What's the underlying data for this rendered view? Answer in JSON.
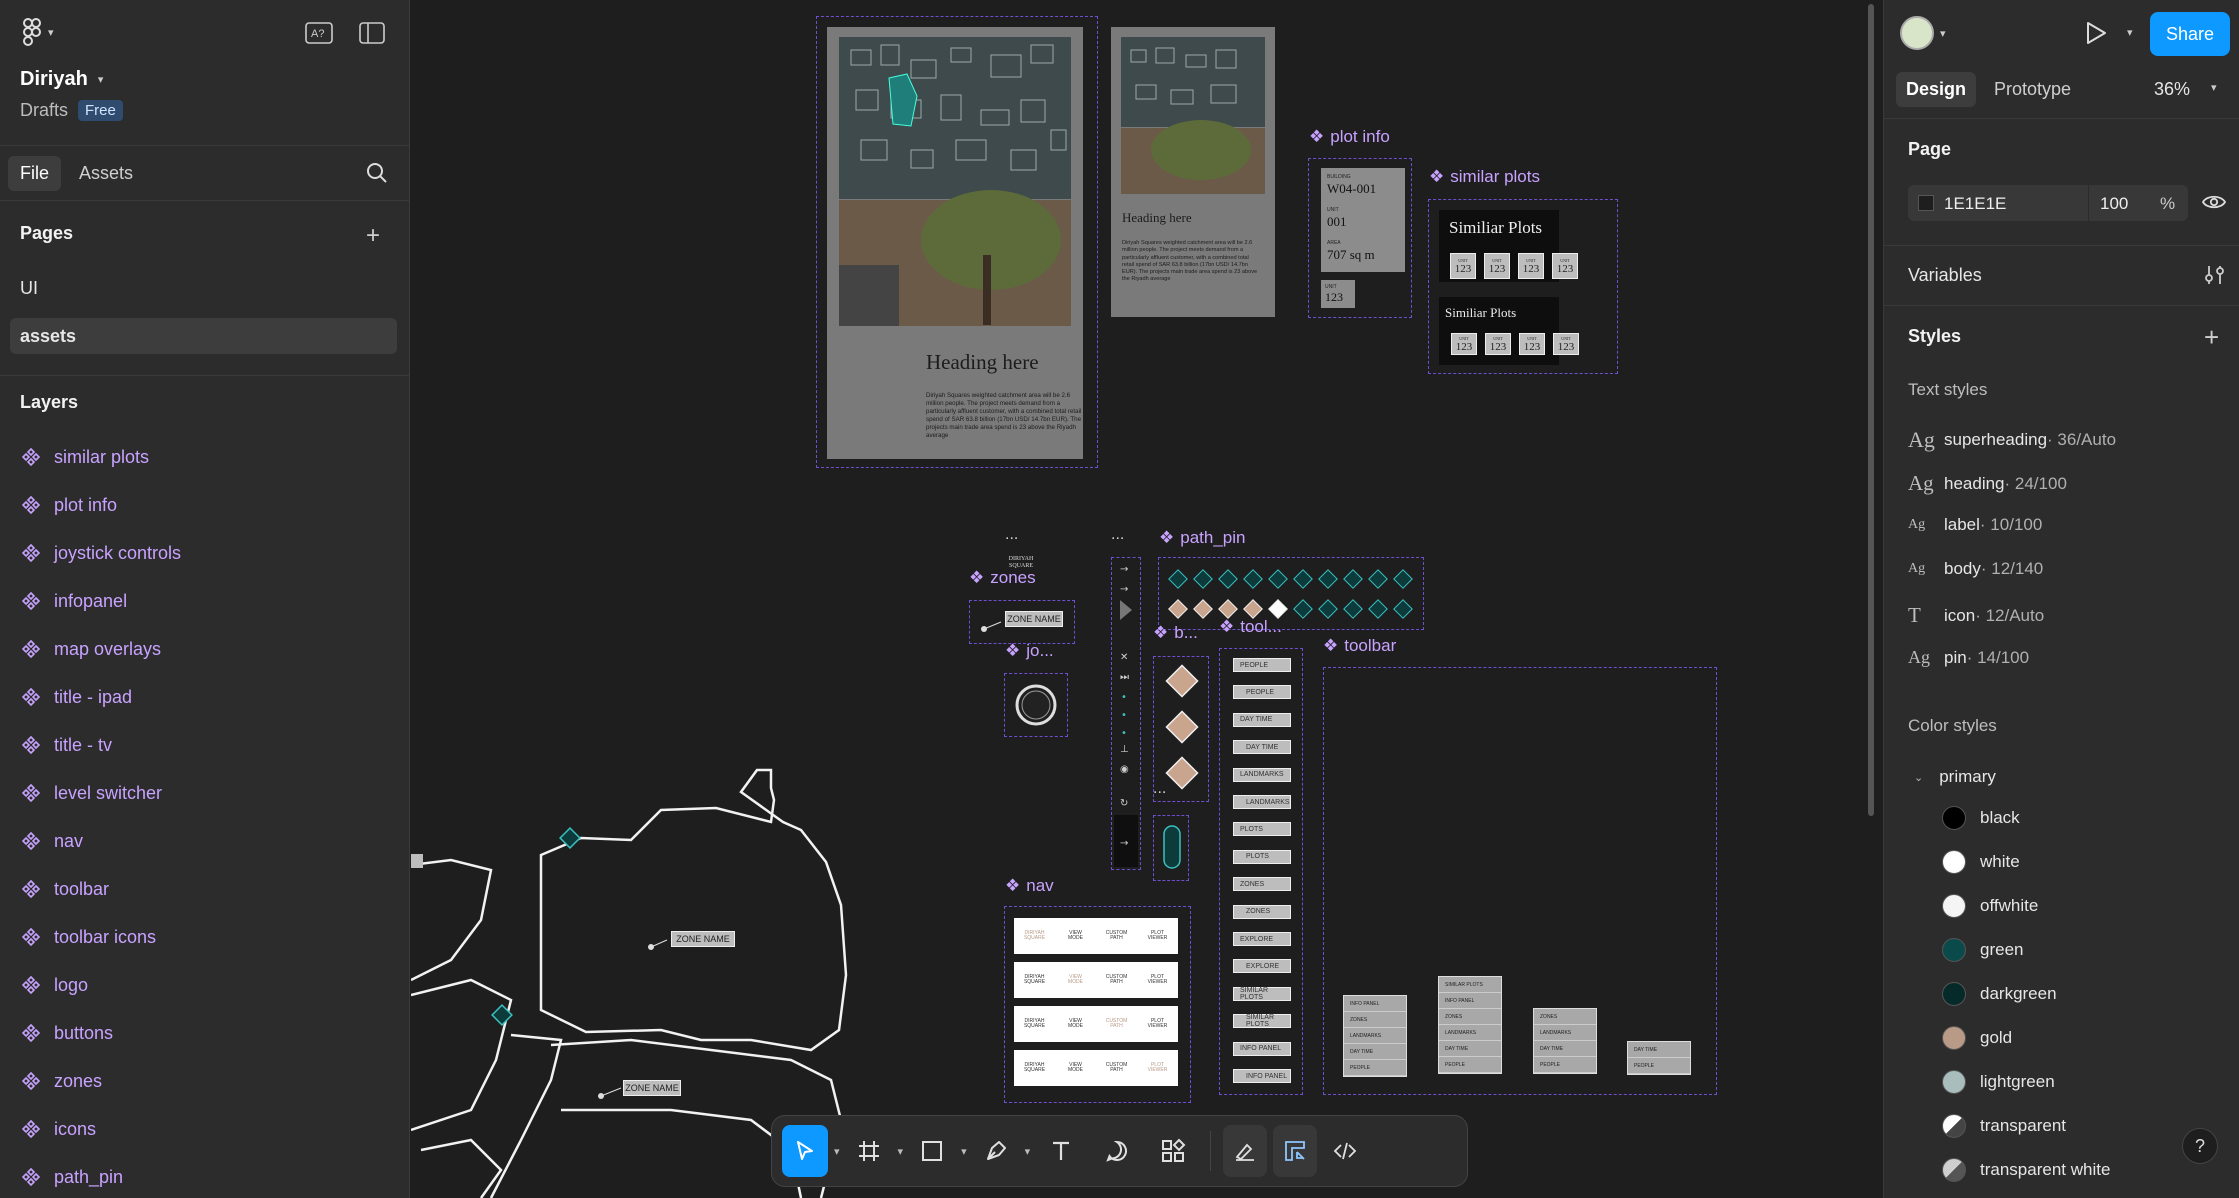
{
  "file": {
    "name": "Diriyah",
    "location": "Drafts",
    "plan": "Free"
  },
  "left_tabs": {
    "file": "File",
    "assets": "Assets"
  },
  "pages": {
    "title": "Pages",
    "items": [
      "UI",
      "assets"
    ],
    "selected": "assets"
  },
  "layers": {
    "title": "Layers",
    "items": [
      "similar plots",
      "plot info",
      "joystick controls",
      "infopanel",
      "map overlays",
      "title - ipad",
      "title - tv",
      "level switcher",
      "nav",
      "toolbar",
      "toolbar icons",
      "logo",
      "buttons",
      "zones",
      "icons",
      "path_pin"
    ]
  },
  "right": {
    "share": "Share",
    "tabs": {
      "design": "Design",
      "prototype": "Prototype"
    },
    "zoom": "36%",
    "page_section": "Page",
    "page_color": "1E1E1E",
    "page_opacity": "100",
    "percent": "%",
    "variables": "Variables",
    "styles": "Styles",
    "text_styles_title": "Text styles",
    "text_styles": [
      {
        "glyph": "Ag",
        "name": "superheading",
        "meta": " · 36/Auto"
      },
      {
        "glyph": "Ag",
        "name": "heading",
        "meta": " · 24/100"
      },
      {
        "glyph": "Ag",
        "name": "label",
        "meta": " · 10/100"
      },
      {
        "glyph": "Ag",
        "name": "body",
        "meta": " · 12/140"
      },
      {
        "glyph": "T",
        "name": "icon",
        "meta": " · 12/Auto"
      },
      {
        "glyph": "Ag",
        "name": "pin",
        "meta": " · 14/100"
      }
    ],
    "color_styles_title": "Color styles",
    "color_group": "primary",
    "colors": [
      {
        "name": "black",
        "hex": "#000000"
      },
      {
        "name": "white",
        "hex": "#ffffff"
      },
      {
        "name": "offwhite",
        "hex": "#f5f5f5"
      },
      {
        "name": "green",
        "hex": "#0b4a4a"
      },
      {
        "name": "darkgreen",
        "hex": "#062a2a"
      },
      {
        "name": "gold",
        "hex": "#b89a87"
      },
      {
        "name": "lightgreen",
        "hex": "#a9bdbd"
      },
      {
        "name": "transparent",
        "hex": "#ffffff"
      },
      {
        "name": "transparent white",
        "hex": "#cccccc"
      }
    ]
  },
  "canvas": {
    "frames": {
      "plot_info": "plot info",
      "similar_plots": "similar plots",
      "path_pin": "path_pin",
      "zones": "zones",
      "jo": "jo...",
      "b": "b...",
      "tool": "tool...",
      "toolbar": "toolbar",
      "nav": "nav"
    },
    "ellipsis": "...",
    "infopanel": {
      "heading_large": "Heading here",
      "heading_small": "Heading here",
      "body": "Diriyah Squares weighted catchment area will be 2.6 million people. The project meets demand from a particularly affluent customer, with a combined total retail spend of SAR 63.8 billion (17bn USD/ 14.7bn EUR). The projects main trade area spend is 23 above the Riyadh average"
    },
    "plot_info_card": {
      "building_label": "BUILDING",
      "building": "W04-001",
      "unit_label": "UNIT",
      "unit": "001",
      "area_label": "AREA",
      "area": "707 sq m",
      "unit2_label": "UNIT",
      "unit2": "123"
    },
    "similar": {
      "title1": "Similiar Plots",
      "title2": "Similiar Plots",
      "chip_label": "UNIT",
      "chip_value": "123"
    },
    "zone_name": "ZONE NAME",
    "diriyah_square": "DIRIYAH SQUARE",
    "toolbar_items": [
      "PEOPLE",
      "PEOPLE",
      "DAY TIME",
      "DAY TIME",
      "LANDMARKS",
      "LANDMARKS",
      "PLOTS",
      "PLOTS",
      "ZONES",
      "ZONES",
      "EXPLORE",
      "EXPLORE",
      "SIMILAR PLOTS",
      "SIMILAR PLOTS",
      "INFO PANEL",
      "INFO PANEL"
    ],
    "nav_items": [
      "DIRIYAH SQUARE",
      "VIEW MODE",
      "CUSTOM PATH",
      "PLOT VIEWER"
    ],
    "panel_stacks": {
      "a": [
        "INFO PANEL",
        "ZONES",
        "LANDMARKS",
        "DAY TIME",
        "PEOPLE"
      ],
      "b": [
        "SIMILAR PLOTS",
        "INFO PANEL",
        "ZONES",
        "LANDMARKS",
        "DAY TIME",
        "PEOPLE"
      ],
      "c": [
        "ZONES",
        "LANDMARKS",
        "DAY TIME",
        "PEOPLE"
      ],
      "d": [
        "DAY TIME",
        "PEOPLE"
      ]
    }
  }
}
